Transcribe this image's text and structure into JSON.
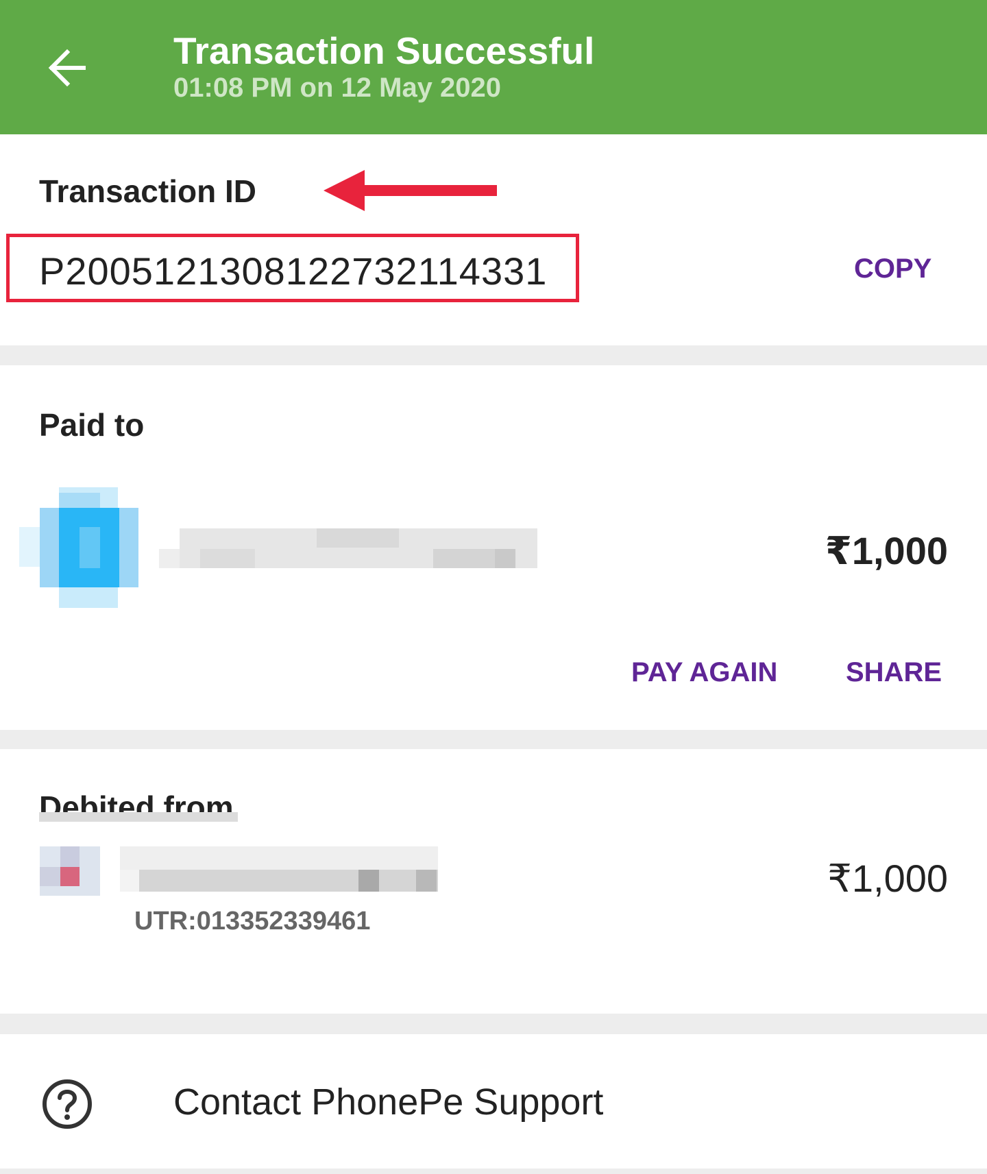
{
  "header": {
    "title": "Transaction Successful",
    "subtitle": "01:08 PM on 12 May 2020",
    "back_icon": "arrow-left-icon",
    "background_color": "#5faa47"
  },
  "transaction": {
    "label": "Transaction ID",
    "id": "P2005121308122732114331",
    "copy_label": "COPY",
    "annotation_arrow_icon": "red-arrow-left-icon",
    "highlight_color": "#e8233c"
  },
  "paid_to": {
    "label": "Paid to",
    "amount": "₹1,000",
    "pay_again_label": "PAY AGAIN",
    "share_label": "SHARE",
    "avatar_icon": "blurred-avatar-icon"
  },
  "debited_from": {
    "label": "Debited from",
    "amount": "₹1,000",
    "utr": "UTR:013352339461",
    "bank_icon": "blurred-bank-icon"
  },
  "support": {
    "label": "Contact PhonePe Support",
    "icon": "help-circle-icon"
  },
  "colors": {
    "accent": "#5f2596",
    "divider": "#ededed"
  }
}
